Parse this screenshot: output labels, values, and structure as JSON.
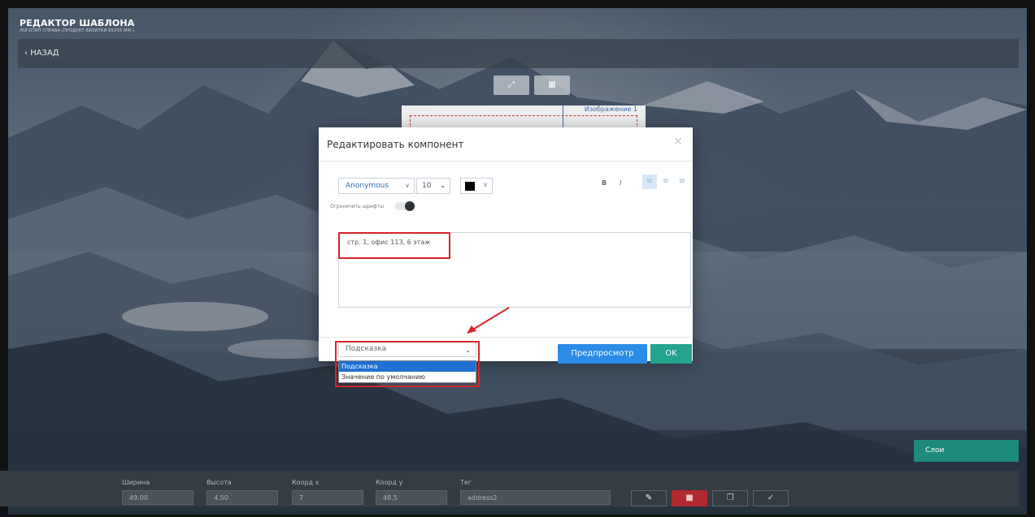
{
  "header": {
    "title": "РЕДАКТОР ШАБЛОНА",
    "subtitle": "ЛОГОТИП СПРАВА (ПРОДУКТ ВИЗИТКИ 85X55 ММ.)",
    "back_label": "НАЗАД"
  },
  "canvas": {
    "image_label": "Изображение 1"
  },
  "modal": {
    "title": "Редактировать компонент",
    "close_icon": "close-icon",
    "font": {
      "family": "Anonymous",
      "size": "10"
    },
    "text_color": "#000000",
    "bold_label": "B",
    "italic_label": "I",
    "limit_fonts_label": "Ограничить шрифты",
    "text_value": "стр. 1, офис 113, 6 этаж",
    "hint_select": {
      "value": "Подсказка",
      "options": [
        "Подсказка",
        "Значение по умолчанию"
      ]
    },
    "preview_label": "Предпросмотр",
    "ok_label": "OK"
  },
  "layers_label": "Слои",
  "bottom": {
    "width": {
      "label": "Ширина",
      "value": "49.00"
    },
    "height": {
      "label": "Высота",
      "value": "4.50"
    },
    "coord_x": {
      "label": "Коорд х",
      "value": "7"
    },
    "coord_y": {
      "label": "Коорд у",
      "value": "48.5"
    },
    "tag": {
      "label": "Тег",
      "value": "address2"
    }
  },
  "colors": {
    "preview": "#2a8ce6",
    "ok": "#24a38f",
    "delete": "#b02a30",
    "highlight": "#d8242a",
    "layers": "#1d8a7c"
  }
}
